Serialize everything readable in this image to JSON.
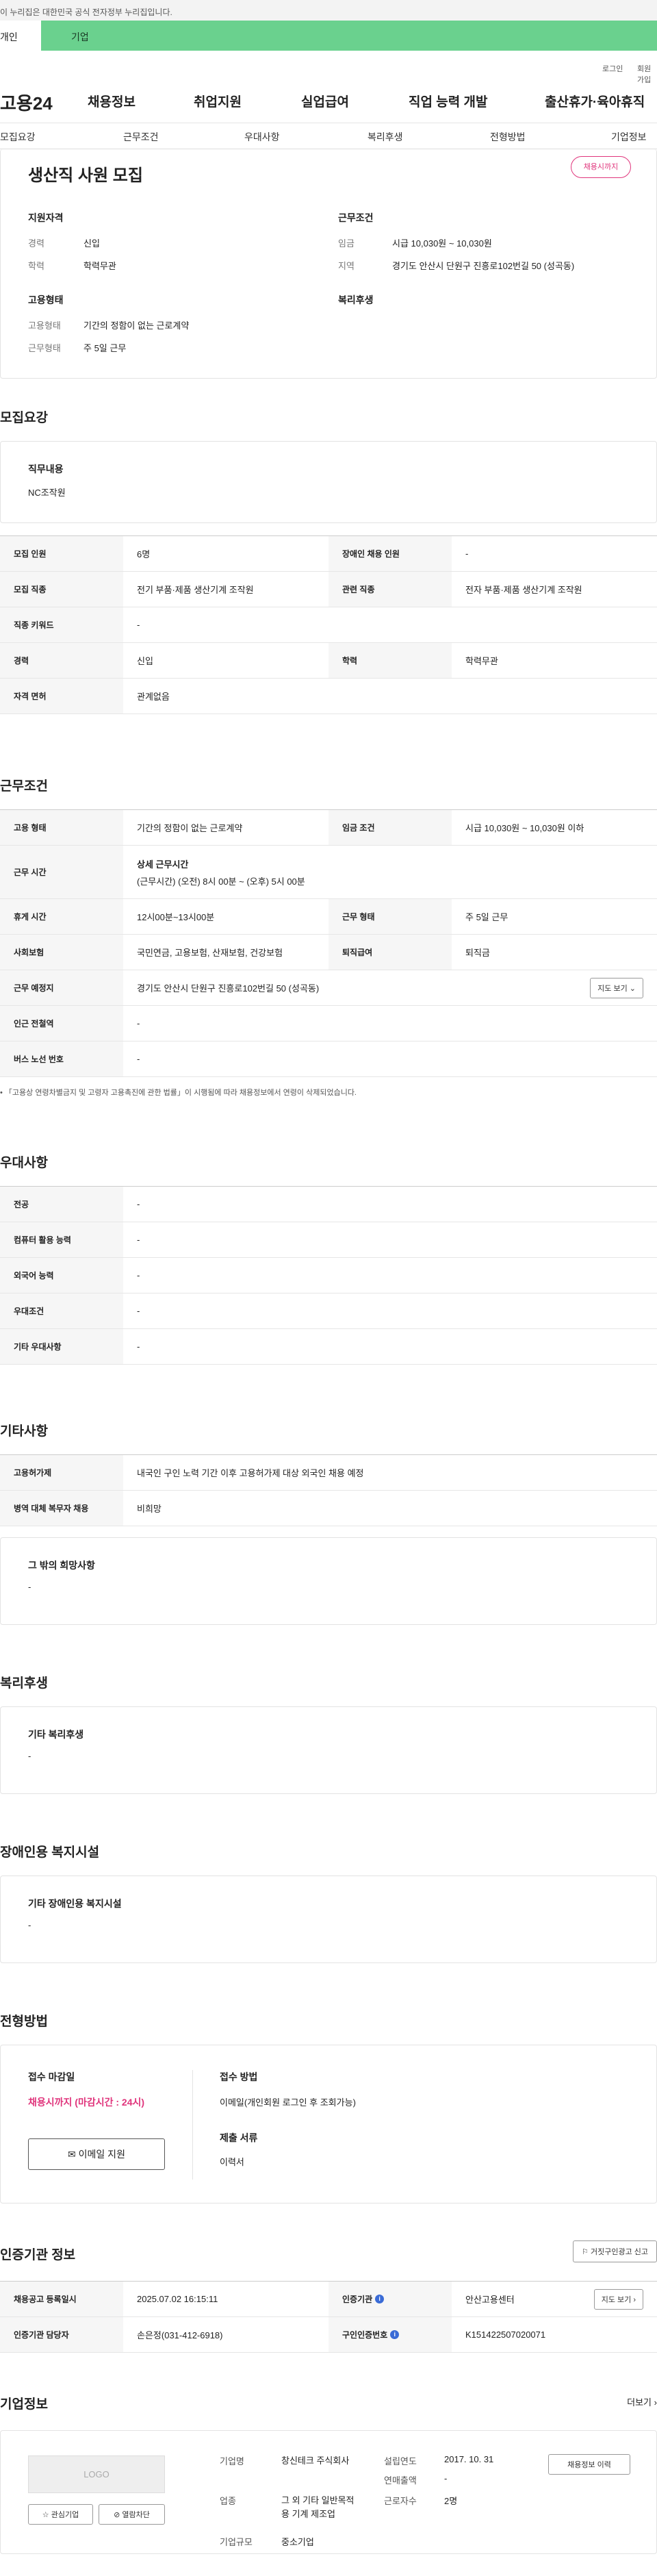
{
  "gov_banner": "이 누리집은 대한민국 공식 전자정부 누리집입니다.",
  "user_types": {
    "individual": "개인",
    "corporate": "기업"
  },
  "util": {
    "login": "로그인",
    "signup": "회원가입"
  },
  "gnb": {
    "logo": "고용24",
    "items": [
      "채용정보",
      "취업지원",
      "실업급여",
      "직업 능력 개발",
      "출산휴가·육아휴직"
    ]
  },
  "tabs": [
    "모집요강",
    "근무조건",
    "우대사항",
    "복리후생",
    "전형방법",
    "기업정보"
  ],
  "summary": {
    "title": "생산직 사원 모집",
    "badge": "채용시까지",
    "qual_title": "지원자격",
    "career_label": "경력",
    "career_value": "신입",
    "edu_label": "학력",
    "edu_value": "학력무관",
    "emp_title": "고용형태",
    "emptype_label": "고용형태",
    "emptype_value": "기간의 정함이 없는 근로계약",
    "worktype_label": "근무형태",
    "worktype_value": "주 5일 근무",
    "cond_title": "근무조건",
    "wage_label": "임금",
    "wage_value": "시급 10,030원 ~ 10,030원",
    "region_label": "지역",
    "region_value": "경기도 안산시 단원구 진흥로102번길 50 (성곡동)",
    "welfare_title": "복리후생"
  },
  "recruit": {
    "title": "모집요강",
    "duty_label": "직무내용",
    "duty_value": "NC조작원",
    "people_label": "모집 인원",
    "people_value": "6명",
    "disabled_label": "장애인 채용 인원",
    "disabled_value": "-",
    "job_label": "모집 직종",
    "job_value": "전기 부품·제품 생산기계 조작원",
    "related_label": "관련 직종",
    "related_value": "전자 부품·제품 생산기계 조작원",
    "keyword_label": "직종 키워드",
    "keyword_value": "-",
    "career_label": "경력",
    "career_value": "신입",
    "edu_label": "학력",
    "edu_value": "학력무관",
    "license_label": "자격 면허",
    "license_value": "관계없음"
  },
  "conditions": {
    "title": "근무조건",
    "emptype_label": "고용 형태",
    "emptype_value": "기간의 정함이 없는 근로계약",
    "wage_label": "임금 조건",
    "wage_value": "시급 10,030원 ~ 10,030원 이하",
    "hours_label": "근무 시간",
    "hours_detail_title": "상세 근무시간",
    "hours_value": "(근무시간) (오전) 8시 00분 ~ (오후) 5시 00분",
    "break_label": "휴게 시간",
    "break_value": "12시00분~13시00분",
    "shift_label": "근무 형태",
    "shift_value": "주 5일 근무",
    "insurance_label": "사회보험",
    "insurance_value": "국민연금, 고용보험, 산재보험, 건강보험",
    "severance_label": "퇴직급여",
    "severance_value": "퇴직금",
    "place_label": "근무 예정지",
    "place_value": "경기도 안산시 단원구 진흥로102번길 50 (성곡동)",
    "map_button": "지도 보기",
    "subway_label": "인근 전철역",
    "subway_value": "-",
    "bus_label": "버스 노선 번호",
    "bus_value": "-",
    "note": "「고용상 연령차별금지 및 고령자 고용촉진에 관한 법률」이 시행됨에 따라 채용정보에서 연령이 삭제되었습니다."
  },
  "preferences": {
    "title": "우대사항",
    "rows": [
      {
        "label": "전공",
        "value": "-"
      },
      {
        "label": "컴퓨터 활용 능력",
        "value": "-"
      },
      {
        "label": "외국어 능력",
        "value": "-"
      },
      {
        "label": "우대조건",
        "value": "-"
      },
      {
        "label": "기타 우대사항",
        "value": "-"
      }
    ]
  },
  "etc": {
    "title": "기타사항",
    "permit_label": "고용허가제",
    "permit_value": "내국인 구인 노력 기간 이후 고용허가제 대상 외국인 채용 예정",
    "military_label": "병역 대체 복무자 채용",
    "military_value": "비희망",
    "other_title": "그 밖의 희망사항",
    "other_value": "-"
  },
  "welfare": {
    "title": "복리후생",
    "other_title": "기타 복리후생",
    "other_value": "-"
  },
  "disabled_fac": {
    "title": "장애인용 복지시설",
    "other_title": "기타 장애인용 복지시설",
    "other_value": "-"
  },
  "process": {
    "title": "전형방법",
    "deadline_label": "접수 마감일",
    "deadline_value": "채용시까지 (마감시간 : 24시)",
    "email_button": "이메일 지원",
    "method_label": "접수 방법",
    "method_value": "이메일(개인회원 로그인 후 조회가능)",
    "docs_label": "제출 서류",
    "docs_value": "이력서"
  },
  "certification": {
    "title": "인증기관 정보",
    "report_button": "거짓구인광고 신고",
    "reg_label": "채용공고 등록일시",
    "reg_value": "2025.07.02 16:15:11",
    "org_label": "인증기관",
    "org_value": "안산고용센터",
    "manager_label": "인증기관 담당자",
    "manager_value": "손은정(031-412-6918)",
    "num_label": "구인인증번호",
    "num_value": "K151422507020071",
    "map_button": "지도 보기",
    "info_icon": "i"
  },
  "company": {
    "title": "기업정보",
    "more": "더보기",
    "logo_text": "LOGO",
    "fav_button": "관심기업",
    "block_button": "열람차단",
    "name_label": "기업명",
    "name_value": "창신테크 주식회사",
    "industry_label": "업종",
    "industry_value": "그 외 기타 일반목적용 기계 제조업",
    "size_label": "기업규모",
    "size_value": "중소기업",
    "founded_label": "설립연도",
    "founded_value": "2017. 10. 31",
    "revenue_label": "연매출액",
    "revenue_value": "-",
    "employees_label": "근로자수",
    "employees_value": "2명",
    "history_button": "채용정보 이력"
  }
}
